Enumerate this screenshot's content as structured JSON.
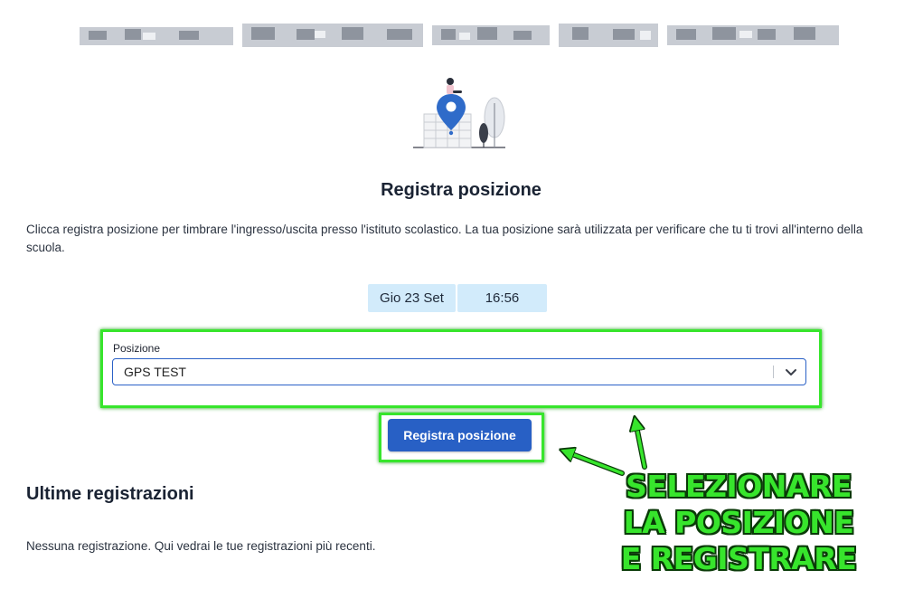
{
  "header": {
    "redacted_title": ""
  },
  "page": {
    "title": "Registra posizione",
    "description": "Clicca registra posizione per timbrare l'ingresso/uscita presso l'istituto scolastico. La tua posizione sarà utilizzata per verificare che tu ti trovi all'interno della scuola."
  },
  "datetime": {
    "date": "Gio 23 Set",
    "time": "16:56"
  },
  "position_field": {
    "label": "Posizione",
    "selected_value": "GPS TEST"
  },
  "actions": {
    "register_label": "Registra posizione"
  },
  "recent": {
    "title": "Ultime registrazioni",
    "empty_message": "Nessuna registrazione. Qui vedrai le tue registrazioni più recenti."
  },
  "annotation": {
    "lines": [
      "SELEZIONARE",
      "LA POSIZIONE",
      "E REGISTRARE"
    ],
    "color": "#37e52c"
  },
  "colors": {
    "primary": "#2860c5",
    "chip_background": "#d2ebfb",
    "highlight": "#37e52c"
  }
}
